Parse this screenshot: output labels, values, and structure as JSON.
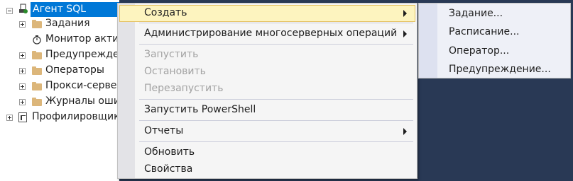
{
  "tree": {
    "root_label": "Агент SQL Server",
    "items": [
      {
        "label": "Задания",
        "icon": "folder-icon"
      },
      {
        "label": "Монитор акти",
        "icon": "monitor-icon"
      },
      {
        "label": "Предупрежден",
        "icon": "folder-icon"
      },
      {
        "label": "Операторы",
        "icon": "folder-icon"
      },
      {
        "label": "Прокси-сервер",
        "icon": "folder-icon"
      },
      {
        "label": "Журналы оши",
        "icon": "folder-icon"
      }
    ],
    "profiler_label": "Профилировщик"
  },
  "context_menu": {
    "items": [
      {
        "label": "Создать",
        "submenu": true,
        "highlighted": true,
        "enabled": true
      },
      {
        "label": "Администрирование многосерверных операций",
        "submenu": true,
        "enabled": true
      },
      {
        "label": "Запустить",
        "enabled": false
      },
      {
        "label": "Остановить",
        "enabled": false
      },
      {
        "label": "Перезапустить",
        "enabled": false
      },
      {
        "label": "Запустить PowerShell",
        "enabled": true
      },
      {
        "label": "Отчеты",
        "submenu": true,
        "enabled": true
      },
      {
        "label": "Обновить",
        "enabled": true
      },
      {
        "label": "Свойства",
        "enabled": true
      }
    ]
  },
  "submenu": {
    "items": [
      "Задание...",
      "Расписание...",
      "Оператор...",
      "Предупреждение..."
    ]
  },
  "colors": {
    "background": "#293955",
    "selection": "#0078d7",
    "highlight": "#fdf4bf",
    "folder": "#dcb67a"
  }
}
